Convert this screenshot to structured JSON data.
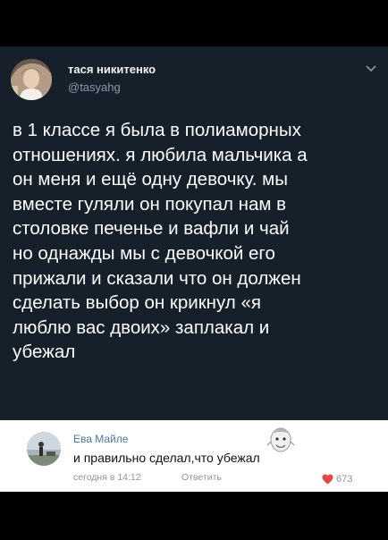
{
  "tweet": {
    "author_name": "тася никитенко",
    "author_handle": "@tasyahg",
    "text": "в 1 классе я была в полиаморных\nотношениях. я любила мальчика а\nон меня и ещё одну девочку. мы\nвместе гуляли он покупал нам в\nстоловке печенье и вафли и чай\nно однажды мы с девочкой его\nприжали и сказали что он должен\nсделать выбор он крикнул «я\nлюблю вас двоих» заплакал и\nубежал",
    "menu_icon": "chevron-down-icon"
  },
  "comment": {
    "author_name": "Ева Майле",
    "text": "и правильно сделал,что убежал",
    "time": "сегодня в 14:12",
    "reply_label": "Ответить",
    "like_count": "673",
    "like_icon": "heart-icon",
    "like_color": "#e64646",
    "name_color": "#4a76a8"
  },
  "colors": {
    "tweet_background": "#15202b",
    "page_background": "#000000",
    "comment_background": "#ffffff"
  }
}
